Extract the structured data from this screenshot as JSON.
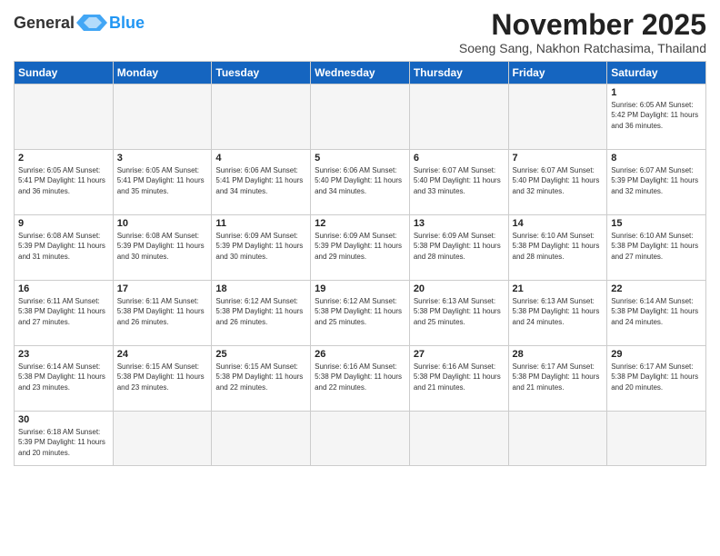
{
  "logo": {
    "text_general": "General",
    "text_blue": "Blue"
  },
  "header": {
    "title": "November 2025",
    "subtitle": "Soeng Sang, Nakhon Ratchasima, Thailand"
  },
  "days_of_week": [
    "Sunday",
    "Monday",
    "Tuesday",
    "Wednesday",
    "Thursday",
    "Friday",
    "Saturday"
  ],
  "weeks": [
    [
      {
        "day": "",
        "info": ""
      },
      {
        "day": "",
        "info": ""
      },
      {
        "day": "",
        "info": ""
      },
      {
        "day": "",
        "info": ""
      },
      {
        "day": "",
        "info": ""
      },
      {
        "day": "",
        "info": ""
      },
      {
        "day": "1",
        "info": "Sunrise: 6:05 AM\nSunset: 5:42 PM\nDaylight: 11 hours and 36 minutes."
      }
    ],
    [
      {
        "day": "2",
        "info": "Sunrise: 6:05 AM\nSunset: 5:41 PM\nDaylight: 11 hours and 36 minutes."
      },
      {
        "day": "3",
        "info": "Sunrise: 6:05 AM\nSunset: 5:41 PM\nDaylight: 11 hours and 35 minutes."
      },
      {
        "day": "4",
        "info": "Sunrise: 6:06 AM\nSunset: 5:41 PM\nDaylight: 11 hours and 34 minutes."
      },
      {
        "day": "5",
        "info": "Sunrise: 6:06 AM\nSunset: 5:40 PM\nDaylight: 11 hours and 34 minutes."
      },
      {
        "day": "6",
        "info": "Sunrise: 6:07 AM\nSunset: 5:40 PM\nDaylight: 11 hours and 33 minutes."
      },
      {
        "day": "7",
        "info": "Sunrise: 6:07 AM\nSunset: 5:40 PM\nDaylight: 11 hours and 32 minutes."
      },
      {
        "day": "8",
        "info": "Sunrise: 6:07 AM\nSunset: 5:39 PM\nDaylight: 11 hours and 32 minutes."
      }
    ],
    [
      {
        "day": "9",
        "info": "Sunrise: 6:08 AM\nSunset: 5:39 PM\nDaylight: 11 hours and 31 minutes."
      },
      {
        "day": "10",
        "info": "Sunrise: 6:08 AM\nSunset: 5:39 PM\nDaylight: 11 hours and 30 minutes."
      },
      {
        "day": "11",
        "info": "Sunrise: 6:09 AM\nSunset: 5:39 PM\nDaylight: 11 hours and 30 minutes."
      },
      {
        "day": "12",
        "info": "Sunrise: 6:09 AM\nSunset: 5:39 PM\nDaylight: 11 hours and 29 minutes."
      },
      {
        "day": "13",
        "info": "Sunrise: 6:09 AM\nSunset: 5:38 PM\nDaylight: 11 hours and 28 minutes."
      },
      {
        "day": "14",
        "info": "Sunrise: 6:10 AM\nSunset: 5:38 PM\nDaylight: 11 hours and 28 minutes."
      },
      {
        "day": "15",
        "info": "Sunrise: 6:10 AM\nSunset: 5:38 PM\nDaylight: 11 hours and 27 minutes."
      }
    ],
    [
      {
        "day": "16",
        "info": "Sunrise: 6:11 AM\nSunset: 5:38 PM\nDaylight: 11 hours and 27 minutes."
      },
      {
        "day": "17",
        "info": "Sunrise: 6:11 AM\nSunset: 5:38 PM\nDaylight: 11 hours and 26 minutes."
      },
      {
        "day": "18",
        "info": "Sunrise: 6:12 AM\nSunset: 5:38 PM\nDaylight: 11 hours and 26 minutes."
      },
      {
        "day": "19",
        "info": "Sunrise: 6:12 AM\nSunset: 5:38 PM\nDaylight: 11 hours and 25 minutes."
      },
      {
        "day": "20",
        "info": "Sunrise: 6:13 AM\nSunset: 5:38 PM\nDaylight: 11 hours and 25 minutes."
      },
      {
        "day": "21",
        "info": "Sunrise: 6:13 AM\nSunset: 5:38 PM\nDaylight: 11 hours and 24 minutes."
      },
      {
        "day": "22",
        "info": "Sunrise: 6:14 AM\nSunset: 5:38 PM\nDaylight: 11 hours and 24 minutes."
      }
    ],
    [
      {
        "day": "23",
        "info": "Sunrise: 6:14 AM\nSunset: 5:38 PM\nDaylight: 11 hours and 23 minutes."
      },
      {
        "day": "24",
        "info": "Sunrise: 6:15 AM\nSunset: 5:38 PM\nDaylight: 11 hours and 23 minutes."
      },
      {
        "day": "25",
        "info": "Sunrise: 6:15 AM\nSunset: 5:38 PM\nDaylight: 11 hours and 22 minutes."
      },
      {
        "day": "26",
        "info": "Sunrise: 6:16 AM\nSunset: 5:38 PM\nDaylight: 11 hours and 22 minutes."
      },
      {
        "day": "27",
        "info": "Sunrise: 6:16 AM\nSunset: 5:38 PM\nDaylight: 11 hours and 21 minutes."
      },
      {
        "day": "28",
        "info": "Sunrise: 6:17 AM\nSunset: 5:38 PM\nDaylight: 11 hours and 21 minutes."
      },
      {
        "day": "29",
        "info": "Sunrise: 6:17 AM\nSunset: 5:38 PM\nDaylight: 11 hours and 20 minutes."
      }
    ],
    [
      {
        "day": "30",
        "info": "Sunrise: 6:18 AM\nSunset: 5:39 PM\nDaylight: 11 hours and 20 minutes."
      },
      {
        "day": "",
        "info": ""
      },
      {
        "day": "",
        "info": ""
      },
      {
        "day": "",
        "info": ""
      },
      {
        "day": "",
        "info": ""
      },
      {
        "day": "",
        "info": ""
      },
      {
        "day": "",
        "info": ""
      }
    ]
  ]
}
